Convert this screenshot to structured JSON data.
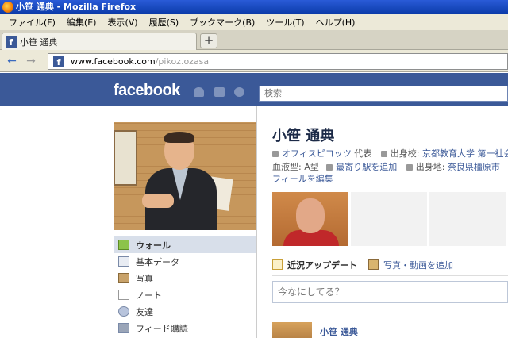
{
  "window": {
    "title": "小笹 通典 - Mozilla Firefox"
  },
  "menubar": {
    "items": [
      "ファイル(F)",
      "編集(E)",
      "表示(V)",
      "履歴(S)",
      "ブックマーク(B)",
      "ツール(T)",
      "ヘルプ(H)"
    ]
  },
  "tab": {
    "label": "小笹 通典",
    "new_tab": "+"
  },
  "nav": {
    "back": "←",
    "forward": "→",
    "url_domain": "www.facebook.com",
    "url_path": "/pikoz.ozasa"
  },
  "fb": {
    "logo": "facebook",
    "search_placeholder": "検索"
  },
  "leftnav": {
    "items": [
      "ウォール",
      "基本データ",
      "写真",
      "ノート",
      "友達",
      "フィード購読"
    ]
  },
  "profile": {
    "name": "小笹 通典",
    "work_link": "オフィスピコッツ",
    "work_role": " 代表",
    "edu_label": "出身校: ",
    "edu_link": "京都教育大学 第一社会",
    "blood": "血液型: A型",
    "station_link": "最寄り駅を追加",
    "hometown_label": "出身地: ",
    "hometown_link": "奈良県橿原市",
    "edit_link": "フィールを編集"
  },
  "publisher": {
    "tab_status": "近況アップデート",
    "tab_photo": "写真・動画を追加",
    "placeholder": "今なにしてる？"
  },
  "story": {
    "name": "小笹 通典"
  }
}
